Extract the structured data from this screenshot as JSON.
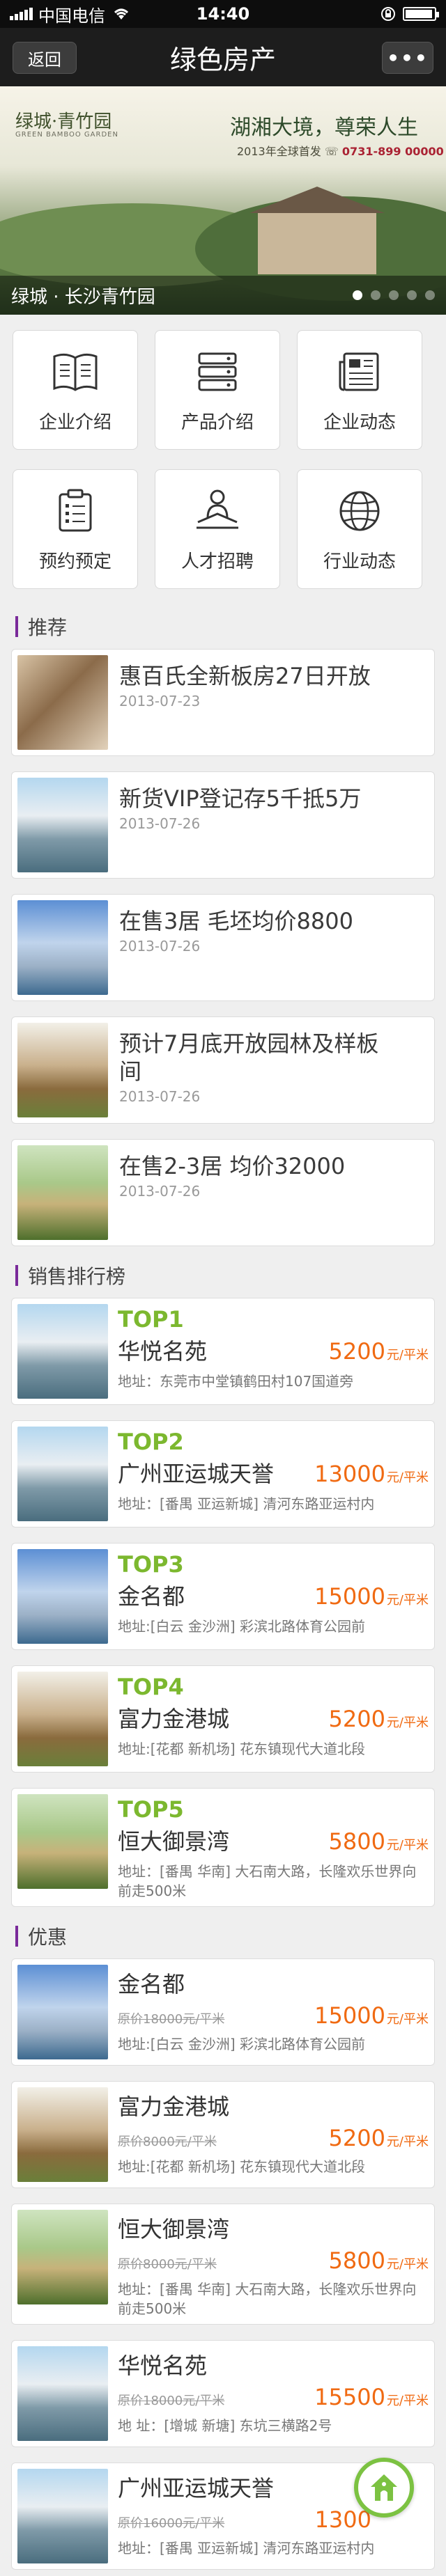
{
  "statusbar": {
    "carrier": "中国电信",
    "time": "14:40",
    "battery_level": 0.95
  },
  "navbar": {
    "back": "返回",
    "title": "绿色房产",
    "more": "•••"
  },
  "banner": {
    "logo": "绿城·青竹园",
    "logo_sub": "GREEN BAMBOO GARDEN",
    "slogan": "湖湘大境，尊荣人生",
    "subline_prefix": "2013年全球首发",
    "phone": "0731-899 00000",
    "caption": "绿城 · 长沙青竹园",
    "slides": 5,
    "active_slide": 1
  },
  "menu": [
    {
      "label": "企业介绍",
      "icon": "book-icon"
    },
    {
      "label": "产品介绍",
      "icon": "server-icon"
    },
    {
      "label": "企业动态",
      "icon": "newspaper-icon"
    },
    {
      "label": "预约预定",
      "icon": "clipboard-icon"
    },
    {
      "label": "人才招聘",
      "icon": "person-desk-icon"
    },
    {
      "label": "行业动态",
      "icon": "globe-icon"
    }
  ],
  "recommend": {
    "title": "推荐",
    "items": [
      {
        "title": "惠百氏全新板房27日开放",
        "date": "2013-07-23"
      },
      {
        "title": "新货VIP登记存5千抵5万",
        "date": "2013-07-26"
      },
      {
        "title": "在售3居 毛坯均价8800",
        "date": "2013-07-26"
      },
      {
        "title": "预计7月底开放园林及样板间",
        "date": "2013-07-26"
      },
      {
        "title": "在售2-3居 均价32000",
        "date": "2013-07-26"
      }
    ]
  },
  "ranking": {
    "title": "销售排行榜",
    "items": [
      {
        "rank": "TOP1",
        "name": "华悦名苑",
        "price": "5200",
        "unit": "元/平米",
        "addr": "地址：东莞市中堂镇鹤田村107国道旁"
      },
      {
        "rank": "TOP2",
        "name": "广州亚运城天誉",
        "price": "13000",
        "unit": "元/平米",
        "addr": "地址：[番禺 亚运新城] 清河东路亚运村内"
      },
      {
        "rank": "TOP3",
        "name": "金名都",
        "price": "15000",
        "unit": "元/平米",
        "addr": "地址:[白云 金沙洲] 彩滨北路体育公园前"
      },
      {
        "rank": "TOP4",
        "name": "富力金港城",
        "price": "5200",
        "unit": "元/平米",
        "addr": "地址:[花都 新机场] 花东镇现代大道北段"
      },
      {
        "rank": "TOP5",
        "name": "恒大御景湾",
        "price": "5800",
        "unit": "元/平米",
        "addr": "地址：[番禺 华南] 大石南大路，长隆欢乐世界向前走500米"
      }
    ]
  },
  "promo": {
    "title": "优惠",
    "items": [
      {
        "name": "金名都",
        "orig": "原价18000元/平米",
        "price": "15000",
        "unit": "元/平米",
        "addr": "地址:[白云 金沙洲] 彩滨北路体育公园前"
      },
      {
        "name": "富力金港城",
        "orig": "原价8000元/平米",
        "price": "5200",
        "unit": "元/平米",
        "addr": "地址:[花都 新机场] 花东镇现代大道北段"
      },
      {
        "name": "恒大御景湾",
        "orig": "原价8000元/平米",
        "price": "5800",
        "unit": "元/平米",
        "addr": "地址：[番禺 华南] 大石南大路，长隆欢乐世界向前走500米"
      },
      {
        "name": "华悦名苑",
        "orig": "原价18000元/平米",
        "price": "15500",
        "unit": "元/平米",
        "addr": "地 址：[增城 新塘] 东坑三横路2号"
      },
      {
        "name": "广州亚运城天誉",
        "orig": "原价16000元/平米",
        "price": "1300",
        "unit": "",
        "addr": "地址：[番禺 亚运新城] 清河东路亚运村内"
      }
    ]
  },
  "colors": {
    "price": "#f06a12",
    "rank": "#7cb82f",
    "section_bar": "#7a2a9a",
    "fab_ring": "#7cc242"
  }
}
